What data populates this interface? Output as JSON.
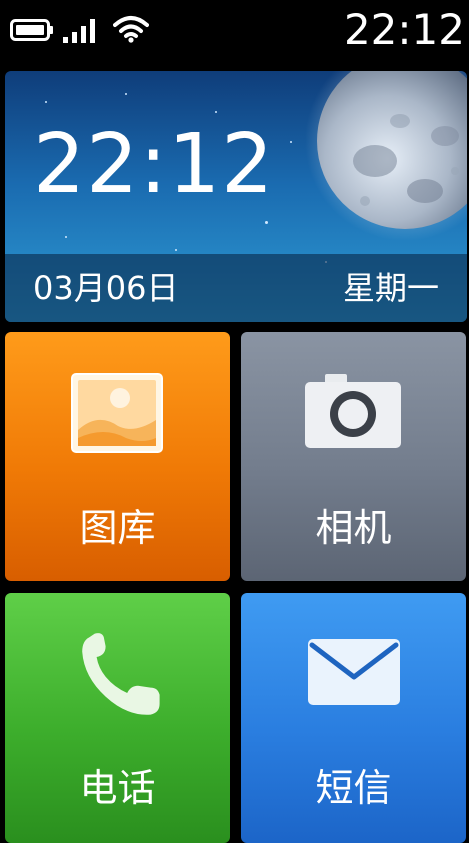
{
  "status_bar": {
    "time": "22:12",
    "icons": [
      "battery-icon",
      "signal-icon",
      "wifi-icon"
    ]
  },
  "clock_widget": {
    "time": "22:12",
    "date": "03月06日",
    "weekday": "星期一"
  },
  "tiles": [
    {
      "label": "图库",
      "icon": "gallery-icon",
      "color": "#f07a06"
    },
    {
      "label": "相机",
      "icon": "camera-icon",
      "color": "#737d8d"
    },
    {
      "label": "电话",
      "icon": "phone-icon",
      "color": "#3dae2c"
    },
    {
      "label": "短信",
      "icon": "envelope-icon",
      "color": "#2a7ee0"
    }
  ]
}
